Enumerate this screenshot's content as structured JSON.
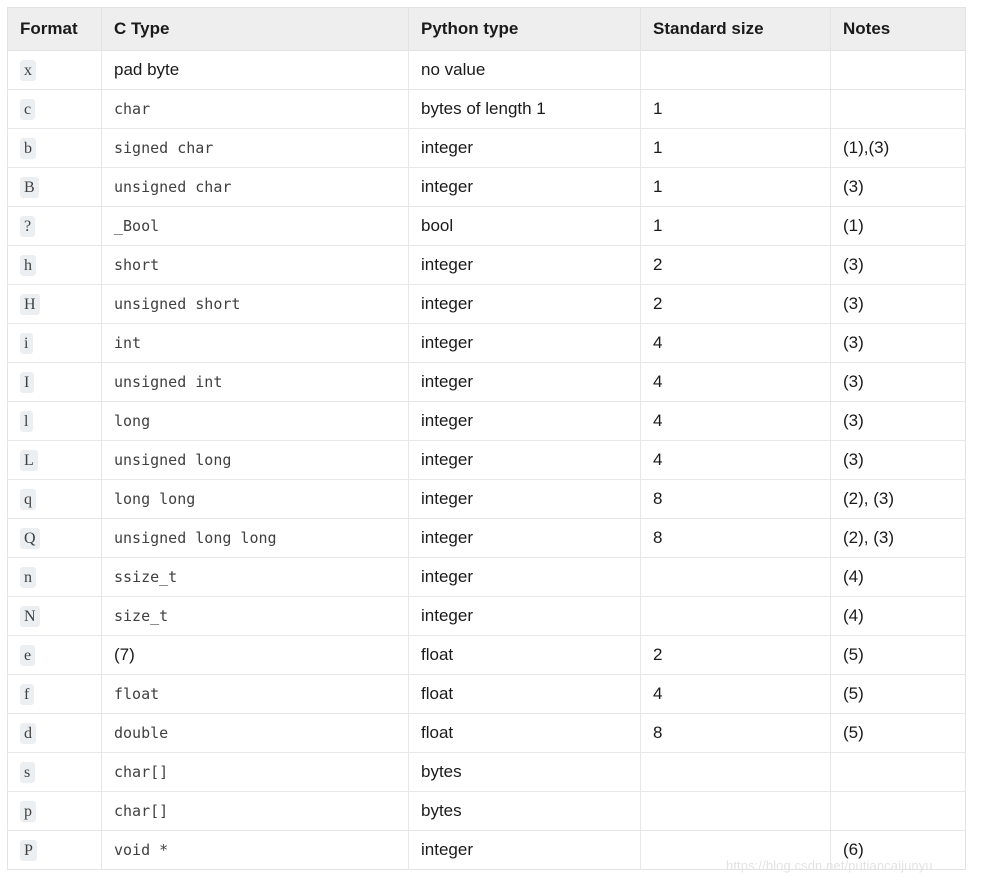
{
  "table": {
    "columns": [
      {
        "key": "format",
        "label": "Format"
      },
      {
        "key": "ctype",
        "label": "C Type"
      },
      {
        "key": "pytype",
        "label": "Python type"
      },
      {
        "key": "stdsize",
        "label": "Standard size"
      },
      {
        "key": "notes",
        "label": "Notes"
      }
    ],
    "rows": [
      {
        "format": "x",
        "ctype": "pad byte",
        "ctype_style": "plain",
        "pytype": "no value",
        "stdsize": "",
        "notes": ""
      },
      {
        "format": "c",
        "ctype": "char",
        "ctype_style": "mono",
        "pytype": "bytes of length 1",
        "stdsize": "1",
        "notes": ""
      },
      {
        "format": "b",
        "ctype": "signed char",
        "ctype_style": "mono",
        "pytype": "integer",
        "stdsize": "1",
        "notes": "(1),(3)"
      },
      {
        "format": "B",
        "ctype": "unsigned char",
        "ctype_style": "mono",
        "pytype": "integer",
        "stdsize": "1",
        "notes": "(3)"
      },
      {
        "format": "?",
        "ctype": "_Bool",
        "ctype_style": "mono",
        "pytype": "bool",
        "stdsize": "1",
        "notes": "(1)"
      },
      {
        "format": "h",
        "ctype": "short",
        "ctype_style": "mono",
        "pytype": "integer",
        "stdsize": "2",
        "notes": "(3)"
      },
      {
        "format": "H",
        "ctype": "unsigned short",
        "ctype_style": "mono",
        "pytype": "integer",
        "stdsize": "2",
        "notes": "(3)"
      },
      {
        "format": "i",
        "ctype": "int",
        "ctype_style": "mono",
        "pytype": "integer",
        "stdsize": "4",
        "notes": "(3)"
      },
      {
        "format": "I",
        "ctype": "unsigned int",
        "ctype_style": "mono",
        "pytype": "integer",
        "stdsize": "4",
        "notes": "(3)"
      },
      {
        "format": "l",
        "ctype": "long",
        "ctype_style": "mono",
        "pytype": "integer",
        "stdsize": "4",
        "notes": "(3)"
      },
      {
        "format": "L",
        "ctype": "unsigned long",
        "ctype_style": "mono",
        "pytype": "integer",
        "stdsize": "4",
        "notes": "(3)"
      },
      {
        "format": "q",
        "ctype": "long long",
        "ctype_style": "mono",
        "pytype": "integer",
        "stdsize": "8",
        "notes": "(2), (3)"
      },
      {
        "format": "Q",
        "ctype": "unsigned long long",
        "ctype_style": "mono",
        "pytype": "integer",
        "stdsize": "8",
        "notes": "(2), (3)"
      },
      {
        "format": "n",
        "ctype": "ssize_t",
        "ctype_style": "mono",
        "pytype": "integer",
        "stdsize": "",
        "notes": "(4)"
      },
      {
        "format": "N",
        "ctype": "size_t",
        "ctype_style": "mono",
        "pytype": "integer",
        "stdsize": "",
        "notes": "(4)"
      },
      {
        "format": "e",
        "ctype": "(7)",
        "ctype_style": "plain",
        "pytype": "float",
        "stdsize": "2",
        "notes": "(5)"
      },
      {
        "format": "f",
        "ctype": "float",
        "ctype_style": "mono",
        "pytype": "float",
        "stdsize": "4",
        "notes": "(5)"
      },
      {
        "format": "d",
        "ctype": "double",
        "ctype_style": "mono",
        "pytype": "float",
        "stdsize": "8",
        "notes": "(5)"
      },
      {
        "format": "s",
        "ctype": "char[]",
        "ctype_style": "mono",
        "pytype": "bytes",
        "stdsize": "",
        "notes": ""
      },
      {
        "format": "p",
        "ctype": "char[]",
        "ctype_style": "mono",
        "pytype": "bytes",
        "stdsize": "",
        "notes": ""
      },
      {
        "format": "P",
        "ctype": "void *",
        "ctype_style": "mono",
        "pytype": "integer",
        "stdsize": "",
        "notes": "(6)"
      }
    ]
  },
  "watermark": {
    "text": "https://blog.csdn.net/putiancaijunyu"
  },
  "colors": {
    "header_background": "#eeeeee",
    "table_border": "#e1e4e5",
    "row_border": "#e5e7e8",
    "text": "#1a1a1a",
    "code_text": "#404040",
    "code_background": "#eceff1",
    "watermark_text": "#e3e3e3",
    "page_background": "#ffffff"
  }
}
